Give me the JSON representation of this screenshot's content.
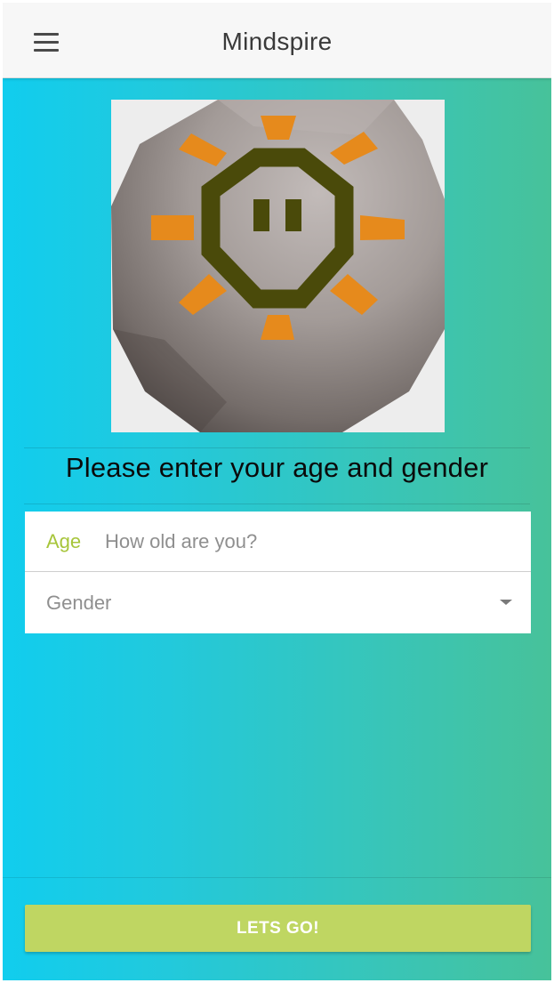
{
  "toolbar": {
    "title": "Mindspire",
    "menu_icon": "hamburger-menu-icon"
  },
  "logo": {
    "icon": "rune-stone-logo-icon",
    "colors": {
      "stone": "#a39b98",
      "face": "#4a4a0a",
      "rays": "#e68a1c"
    }
  },
  "prompt": "Please enter your age and gender",
  "form": {
    "age_label": "Age",
    "age_value": "",
    "age_placeholder": "How old are you?",
    "gender_placeholder": "Gender",
    "gender_icon": "dropdown-caret-icon"
  },
  "submit_label": "LETS GO!",
  "colors": {
    "gradient_start": "#11cdee",
    "gradient_end": "#47c29a",
    "accent": "#a7c53b",
    "button": "#bfd662"
  }
}
